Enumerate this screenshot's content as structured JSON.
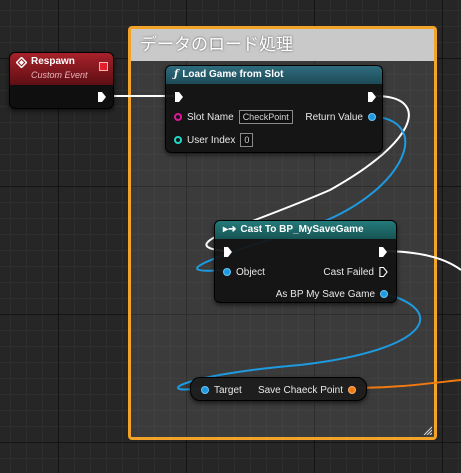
{
  "comment": {
    "title": "データのロード処理",
    "border_color": "#f2a328"
  },
  "nodes": {
    "respawn": {
      "title": "Respawn",
      "subtitle": "Custom Event",
      "icon": "event-diamond-icon",
      "color": "#b0232c"
    },
    "load_game": {
      "title": "Load Game from Slot",
      "icon": "function-icon",
      "slot_name_label": "Slot Name",
      "slot_name_value": "CheckPoint",
      "user_index_label": "User Index",
      "user_index_value": "0",
      "return_value_label": "Return Value"
    },
    "cast": {
      "title": "Cast To BP_MySaveGame",
      "icon": "cast-arrow-icon",
      "object_label": "Object",
      "cast_failed_label": "Cast Failed",
      "as_label": "As BP My Save Game"
    },
    "getter": {
      "target_label": "Target",
      "output_label": "Save Chaeck Point"
    }
  },
  "pin_colors": {
    "exec": "#ffffff",
    "object": "#1e9ae0",
    "string": "#e0179d",
    "integer": "#1fd9c9",
    "struct": "#f07a10"
  }
}
